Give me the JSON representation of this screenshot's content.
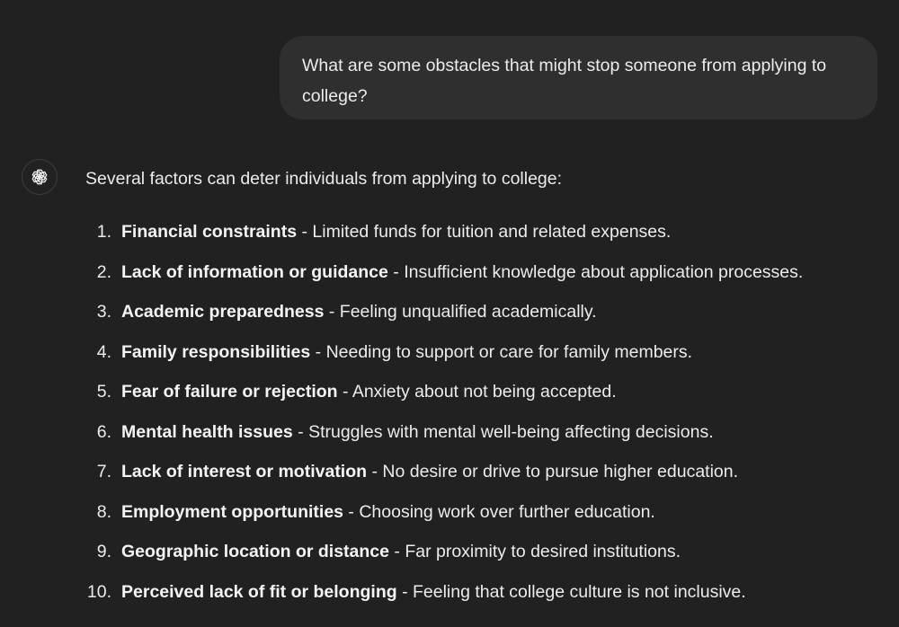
{
  "user_message": {
    "text": "What are some obstacles that might stop someone from applying to college?"
  },
  "assistant": {
    "avatar_icon": "openai-logo-icon",
    "intro": "Several factors can deter individuals from applying to college:",
    "items": [
      {
        "number": "1.",
        "term": "Financial constraints",
        "description": " - Limited funds for tuition and related expenses."
      },
      {
        "number": "2.",
        "term": "Lack of information or guidance",
        "description": " - Insufficient knowledge about application processes."
      },
      {
        "number": "3.",
        "term": "Academic preparedness",
        "description": " - Feeling unqualified academically."
      },
      {
        "number": "4.",
        "term": "Family responsibilities",
        "description": " - Needing to support or care for family members."
      },
      {
        "number": "5.",
        "term": "Fear of failure or rejection",
        "description": " - Anxiety about not being accepted."
      },
      {
        "number": "6.",
        "term": "Mental health issues",
        "description": " - Struggles with mental well-being affecting decisions."
      },
      {
        "number": "7.",
        "term": "Lack of interest or motivation",
        "description": " - No desire or drive to pursue higher education."
      },
      {
        "number": "8.",
        "term": "Employment opportunities",
        "description": " - Choosing work over further education."
      },
      {
        "number": "9.",
        "term": "Geographic location or distance",
        "description": " - Far proximity to desired institutions."
      },
      {
        "number": "10.",
        "term": "Perceived lack of fit or belonging",
        "description": " - Feeling that college culture is not inclusive."
      }
    ]
  },
  "colors": {
    "background": "#212121",
    "user_bubble": "#2f2f2f",
    "text": "#ececec"
  }
}
